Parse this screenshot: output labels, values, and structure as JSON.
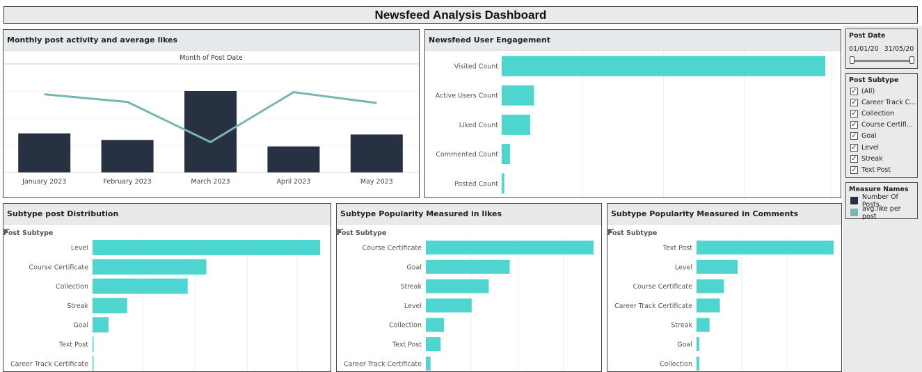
{
  "dashboard_title": "Newsfeed Analysis Dashboard",
  "colors": {
    "dark": "#283142",
    "teal": "#4fd5cf",
    "line": "#76b7b2"
  },
  "panels": {
    "monthly": "Monthly post activity and average likes",
    "engagement": "Newsfeed User Engagement",
    "distribution": "Subtype post Distribution",
    "likes": "Subtype Popularity Measured in likes",
    "comments": "Subtype Popularity Measured in Comments"
  },
  "filters": {
    "post_date": {
      "title": "Post Date",
      "start": "01/01/20",
      "end": "31/05/20"
    },
    "post_subtype": {
      "title": "Post Subtype",
      "options": [
        "(All)",
        "Career Track C...",
        "Collection",
        "Course Certifi...",
        "Goal",
        "Level",
        "Streak",
        "Text Post"
      ]
    },
    "measure_names": {
      "title": "Measure Names",
      "items": [
        {
          "label": "Number Of Posts",
          "color": "#283142"
        },
        {
          "label": "avg.like per post",
          "color": "#76b7b2"
        }
      ]
    }
  },
  "chart_data": [
    {
      "type": "bar",
      "xlabel": "Month of Post Date",
      "categories": [
        "January 2023",
        "February 2023",
        "March 2023",
        "April 2023",
        "May 2023"
      ],
      "series": [
        {
          "name": "Number Of Posts",
          "type": "bar",
          "values": [
            36,
            30,
            75,
            24,
            35
          ]
        },
        {
          "name": "avg.like per post",
          "type": "line",
          "values": [
            72,
            65,
            28,
            74,
            64
          ]
        }
      ]
    },
    {
      "type": "bar",
      "orientation": "horizontal",
      "categories": [
        "Visited Count",
        "Active Users Count",
        "Liked Count",
        "Commented Count",
        "Posted Count"
      ],
      "values": [
        1000,
        100,
        88,
        26,
        8
      ]
    },
    {
      "type": "bar",
      "orientation": "horizontal",
      "axis_header": "Post Subtype",
      "categories": [
        "Level",
        "Course Certificate",
        "Collection",
        "Streak",
        "Goal",
        "Text Post",
        "Career Track Certificate"
      ],
      "values": [
        1000,
        500,
        418,
        152,
        70,
        4,
        3
      ]
    },
    {
      "type": "bar",
      "orientation": "horizontal",
      "axis_header": "Post Subtype",
      "categories": [
        "Course Certificate",
        "Goal",
        "Streak",
        "Level",
        "Collection",
        "Text Post",
        "Career Track Certificate"
      ],
      "values": [
        1000,
        500,
        375,
        273,
        108,
        88,
        28
      ]
    },
    {
      "type": "bar",
      "orientation": "horizontal",
      "axis_header": "Post Subtype",
      "categories": [
        "Text Post",
        "Level",
        "Course Certificate",
        "Career Track Certificate",
        "Streak",
        "Goal",
        "Collection"
      ],
      "values": [
        1000,
        300,
        200,
        170,
        95,
        20,
        20
      ]
    }
  ]
}
